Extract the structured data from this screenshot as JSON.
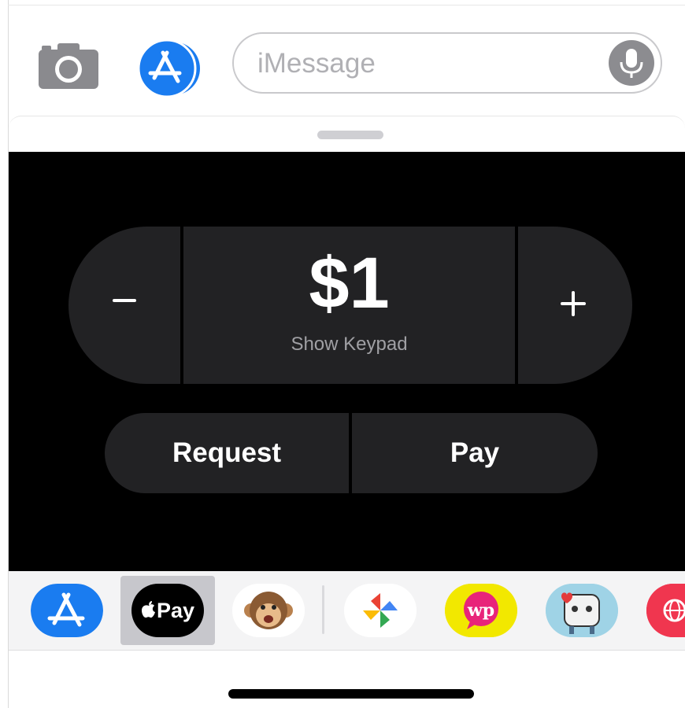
{
  "compose": {
    "placeholder": "iMessage"
  },
  "payment": {
    "amount": "$1",
    "keypad_label": "Show Keypad",
    "request_label": "Request",
    "pay_label": "Pay"
  },
  "app_strip": {
    "apple_pay_label": "Pay",
    "selected_app": "apple-pay"
  },
  "colors": {
    "accent_blue": "#1a7cf0",
    "panel_black": "#000000",
    "control_dark": "#222224",
    "icon_gray": "#8c8c90"
  },
  "icons": [
    "camera-icon",
    "app-store-icon",
    "microphone-icon",
    "minus-icon",
    "plus-icon",
    "apple-logo-icon",
    "monkey-animoji-icon",
    "pinwheel-photos-icon",
    "wp-sticker-icon",
    "ghost-sticker-icon",
    "globe-app-icon"
  ]
}
